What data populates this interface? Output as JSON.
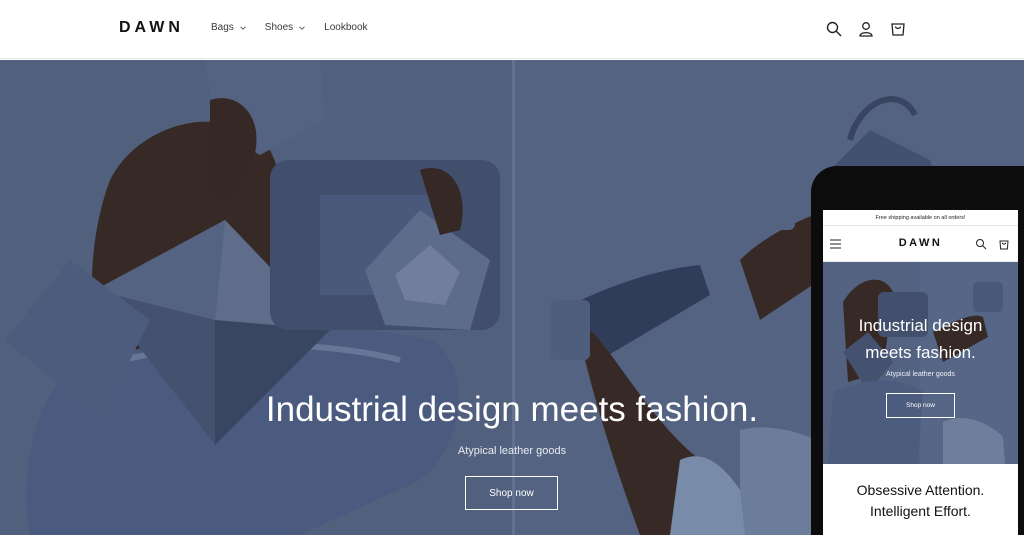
{
  "header": {
    "logo": "DAWN",
    "nav": [
      {
        "label": "Bags",
        "has_dropdown": true
      },
      {
        "label": "Shoes",
        "has_dropdown": true
      },
      {
        "label": "Lookbook",
        "has_dropdown": false
      }
    ],
    "icons": [
      "search-icon",
      "account-icon",
      "cart-icon"
    ]
  },
  "hero": {
    "heading": "Industrial design meets fashion.",
    "subheading": "Atypical leather goods",
    "button_label": "Shop now"
  },
  "mobile": {
    "announcement": "Free shipping available on all orders!",
    "logo": "DAWN",
    "hero_heading_line1": "Industrial design",
    "hero_heading_line2": "meets fashion.",
    "hero_subheading": "Atypical leather goods",
    "hero_button_label": "Shop now",
    "section_line1": "Obsessive Attention.",
    "section_line2": "Intelligent Effort."
  },
  "colors": {
    "hero_blue": "#57698a",
    "text": "#121212",
    "white": "#ffffff"
  }
}
